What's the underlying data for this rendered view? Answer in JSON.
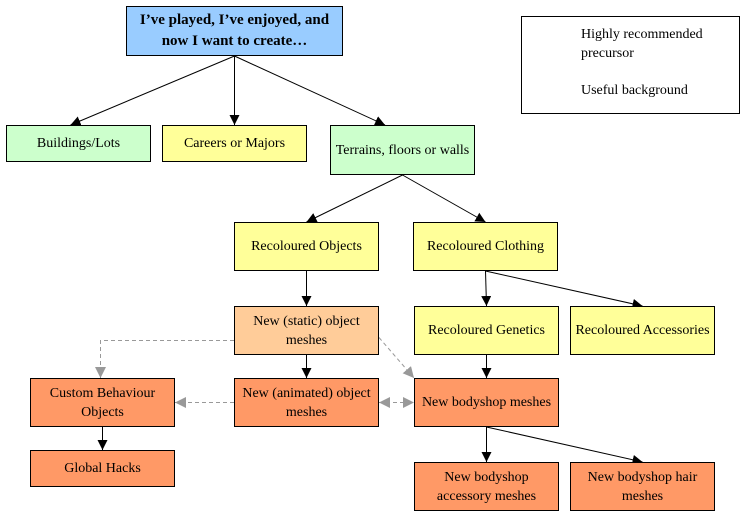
{
  "colors": {
    "blue": "#99ccff",
    "green": "#ccffcc",
    "yellow": "#ffff99",
    "peach": "#ffcc99",
    "orange": "#ff9966",
    "solid_edge": "#000000",
    "dashed_edge": "#999999"
  },
  "nodes": {
    "start": {
      "label": "I’ve played, I’ve enjoyed, and now I want to create…",
      "fill": "blue"
    },
    "buildings": {
      "label": "Buildings/Lots",
      "fill": "green"
    },
    "careers": {
      "label": "Careers or Majors",
      "fill": "yellow"
    },
    "terrains": {
      "label": "Terrains, floors or walls",
      "fill": "green"
    },
    "recol_objects": {
      "label": "Recoloured Objects",
      "fill": "yellow"
    },
    "recol_clothing": {
      "label": "Recoloured Clothing",
      "fill": "yellow"
    },
    "static_meshes": {
      "label": "New (static) object meshes",
      "fill": "peach"
    },
    "recol_genetics": {
      "label": "Recoloured Genetics",
      "fill": "yellow"
    },
    "recol_accessories": {
      "label": "Recoloured Accessories",
      "fill": "yellow"
    },
    "custom_behaviour": {
      "label": "Custom Behaviour Objects",
      "fill": "orange"
    },
    "animated_meshes": {
      "label": "New (animated) object meshes",
      "fill": "orange"
    },
    "bodyshop_meshes": {
      "label": "New bodyshop meshes",
      "fill": "orange"
    },
    "global_hacks": {
      "label": "Global Hacks",
      "fill": "orange"
    },
    "bodyshop_accessory": {
      "label": "New bodyshop accessory meshes",
      "fill": "orange"
    },
    "bodyshop_hair": {
      "label": "New bodyshop hair meshes",
      "fill": "orange"
    }
  },
  "edges": [
    {
      "from": "start",
      "to": "buildings",
      "type": "solid"
    },
    {
      "from": "start",
      "to": "careers",
      "type": "solid"
    },
    {
      "from": "start",
      "to": "terrains",
      "type": "solid"
    },
    {
      "from": "terrains",
      "to": "recol_objects",
      "type": "solid"
    },
    {
      "from": "terrains",
      "to": "recol_clothing",
      "type": "solid"
    },
    {
      "from": "recol_objects",
      "to": "static_meshes",
      "type": "solid"
    },
    {
      "from": "recol_clothing",
      "to": "recol_genetics",
      "type": "solid"
    },
    {
      "from": "recol_clothing",
      "to": "recol_accessories",
      "type": "solid"
    },
    {
      "from": "static_meshes",
      "to": "animated_meshes",
      "type": "solid"
    },
    {
      "from": "recol_genetics",
      "to": "bodyshop_meshes",
      "type": "solid"
    },
    {
      "from": "custom_behaviour",
      "to": "global_hacks",
      "type": "solid"
    },
    {
      "from": "bodyshop_meshes",
      "to": "bodyshop_accessory",
      "type": "solid"
    },
    {
      "from": "bodyshop_meshes",
      "to": "bodyshop_hair",
      "type": "solid"
    },
    {
      "from": "static_meshes",
      "to": "custom_behaviour",
      "type": "dashed"
    },
    {
      "from": "static_meshes",
      "to": "bodyshop_meshes",
      "type": "dashed"
    },
    {
      "from": "animated_meshes",
      "to": "custom_behaviour",
      "type": "dashed"
    },
    {
      "from": "animated_meshes",
      "to": "bodyshop_meshes",
      "type": "dashed-bidirectional"
    }
  ],
  "legend": {
    "solid_label": "Highly recommended precursor",
    "dashed_label": "Useful background"
  }
}
